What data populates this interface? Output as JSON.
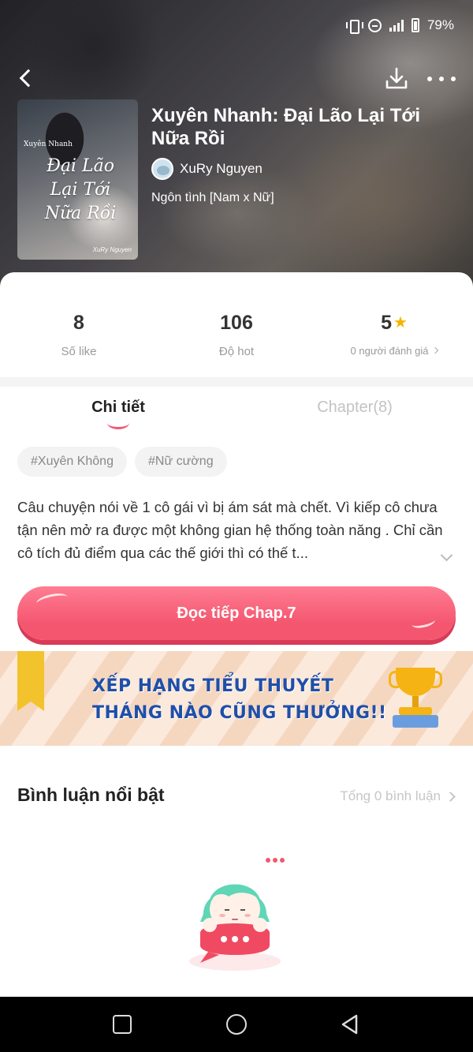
{
  "status_bar": {
    "battery_pct": "79%",
    "icons": [
      "vibrate-icon",
      "do-not-disturb-icon",
      "signal-icon",
      "battery-icon"
    ]
  },
  "header": {
    "back_icon": "back-arrow-icon",
    "download_icon": "download-icon",
    "more_icon": "more-dots-icon"
  },
  "book": {
    "title": "Xuyên Nhanh: Đại Lão Lại Tới Nữa Rồi",
    "author": "XuRy Nguyen",
    "genre": "Ngôn tình [Nam x Nữ]",
    "cover": {
      "small_text": "Xuyên Nhanh",
      "big_text": "Đại Lão Lại Tới Nữa Rồi",
      "author_text": "XuRy Nguyen"
    }
  },
  "stats": {
    "likes": {
      "value": "8",
      "label": "Số like"
    },
    "hot": {
      "value": "106",
      "label": "Độ hot"
    },
    "rating": {
      "value": "5",
      "label": "0 người đánh giá"
    }
  },
  "tabs": [
    {
      "label": "Chi tiết",
      "active": true
    },
    {
      "label": "Chapter(8)",
      "active": false
    }
  ],
  "tags": [
    "#Xuyên Không",
    "#Nữ cường"
  ],
  "description": "Câu chuyện nói về 1 cô gái vì bị ám sát mà chết. Vì kiếp cô chưa tận nên mở ra được một không gian hệ thống toàn năng . Chỉ cần cô tích đủ điểm qua các thế giới thì  có thế t...",
  "continue_button": "Đọc tiếp Chap.7",
  "banner": {
    "line1": "XẾP HẠNG TIỂU THUYẾT",
    "line2": "THÁNG NÀO CŨNG THƯỞNG!!"
  },
  "comments": {
    "title": "Bình luận nổi bật",
    "total": "Tổng 0 bình luận"
  },
  "colors": {
    "accent": "#f4566f",
    "banner_text": "#1f4fa8",
    "star": "#f5b400"
  }
}
